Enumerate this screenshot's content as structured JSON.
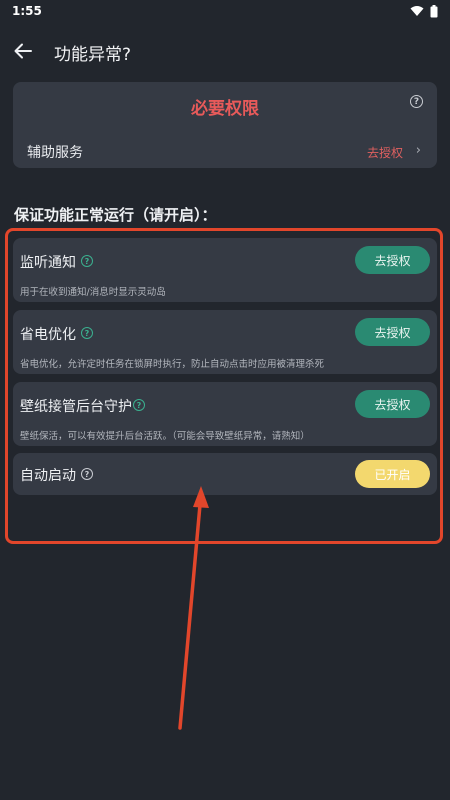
{
  "status_bar": {
    "time": "1:55"
  },
  "app_bar": {
    "title": "功能异常?"
  },
  "required": {
    "title": "必要权限",
    "row_label": "辅助服务",
    "row_action": "去授权",
    "chevron": "›",
    "help": "?"
  },
  "section": {
    "title": "保证功能正常运行（请开启）："
  },
  "items": [
    {
      "title": "监听通知",
      "desc": "用于在收到通知/消息时显示灵动岛",
      "button": "去授权",
      "help": "?"
    },
    {
      "title": "省电优化",
      "desc": "省电优化，允许定时任务在锁屏时执行，防止自动点击时应用被清理杀死",
      "button": "去授权",
      "help": "?"
    },
    {
      "title": "壁纸接管后台守护",
      "desc": "壁纸保活，可以有效提升后台活跃。（可能会导致壁纸异常，请熟知）",
      "button": "去授权",
      "help": "?"
    },
    {
      "title": "自动启动",
      "button": "已开启",
      "help": "?"
    }
  ],
  "colors": {
    "background": "#22262d",
    "card": "#353a44",
    "accent_red": "#e85a5a",
    "grant_green": "#2a8a72",
    "enabled_yellow": "#f3d86e",
    "annotation_red": "#e2462b"
  }
}
